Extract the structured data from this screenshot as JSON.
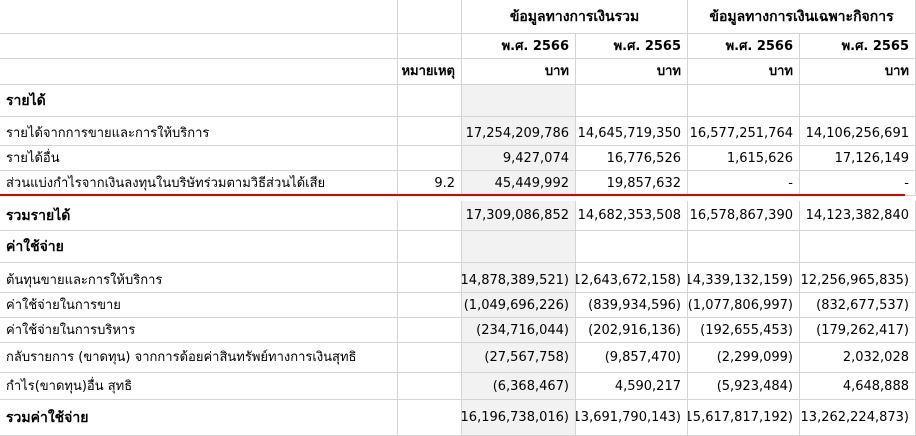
{
  "header": {
    "group_consolidated": "ข้อมูลทางการเงินรวม",
    "group_separate": "ข้อมูลทางการเงินเฉพาะกิจการ",
    "years": [
      "พ.ศ. 2566",
      "พ.ศ. 2565",
      "พ.ศ. 2566",
      "พ.ศ. 2565"
    ],
    "note_label": "หมายเหตุ",
    "units": [
      "บาท",
      "บาท",
      "บาท",
      "บาท"
    ]
  },
  "sections": {
    "revenue_title": "รายได้",
    "expense_title": "ค่าใช้จ่าย"
  },
  "revenue_rows": [
    {
      "label": "รายได้จากการขายและการให้บริการ",
      "note": "",
      "values": [
        "17,254,209,786",
        "14,645,719,350",
        "16,577,251,764",
        "14,106,256,691"
      ]
    },
    {
      "label": "รายได้อื่น",
      "note": "",
      "values": [
        "9,427,074",
        "16,776,526",
        "1,615,626",
        "17,126,149"
      ]
    },
    {
      "label": "ส่วนแบ่งกำไรจากเงินลงทุนในบริษัทร่วมตามวิธีส่วนได้เสีย",
      "note": "9.2",
      "values": [
        "45,449,992",
        "19,857,632",
        "-",
        "-"
      ]
    }
  ],
  "revenue_total": {
    "label": "รวมรายได้",
    "values": [
      "17,309,086,852",
      "14,682,353,508",
      "16,578,867,390",
      "14,123,382,840"
    ]
  },
  "expense_rows": [
    {
      "label": "ต้นทุนขายและการให้บริการ",
      "values": [
        "(14,878,389,521)",
        "(12,643,672,158)",
        "(14,339,132,159)",
        "(12,256,965,835)"
      ]
    },
    {
      "label": "ค่าใช้จ่ายในการขาย",
      "values": [
        "(1,049,696,226)",
        "(839,934,596)",
        "(1,077,806,997)",
        "(832,677,537)"
      ]
    },
    {
      "label": "ค่าใช้จ่ายในการบริหาร",
      "values": [
        "(234,716,044)",
        "(202,916,136)",
        "(192,655,453)",
        "(179,262,417)"
      ]
    },
    {
      "label": "กลับรายการ (ขาดทุน) จากการด้อยค่าสินทรัพย์ทางการเงินสุทธิ",
      "values": [
        "(27,567,758)",
        "(9,857,470)",
        "(2,299,099)",
        "2,032,028"
      ]
    },
    {
      "label": "กำไร(ขาดทุน)อื่น สุทธิ",
      "values": [
        "(6,368,467)",
        "4,590,217",
        "(5,923,484)",
        "4,648,888"
      ]
    }
  ],
  "expense_total": {
    "label": "รวมค่าใช้จ่าย",
    "values": [
      "(16,196,738,016)",
      "(13,691,790,143)",
      "(15,617,817,192)",
      "(13,262,224,873)"
    ]
  },
  "highlight_color": "#e00000"
}
